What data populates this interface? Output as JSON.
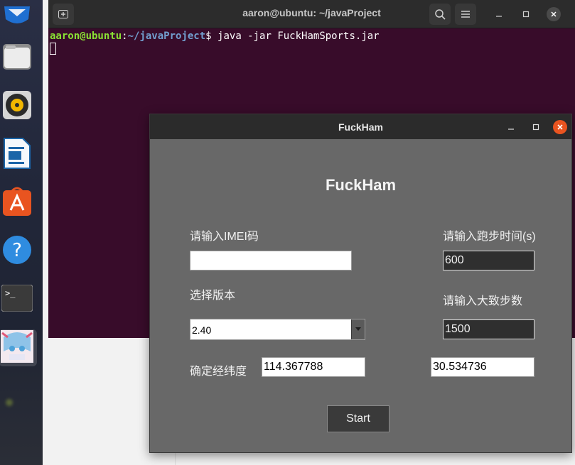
{
  "terminal": {
    "title": "aaron@ubuntu: ~/javaProject",
    "prompt_user": "aaron@ubuntu",
    "prompt_sep": ":",
    "prompt_path": "~/javaProject",
    "prompt_symbol": "$ ",
    "command": "java -jar FuckHamSports.jar"
  },
  "dialog": {
    "title": "FuckHam",
    "heading": "FuckHam",
    "imei_label": "请输入IMEI码",
    "imei_value": "",
    "run_time_label": "请输入跑步时间(s)",
    "run_time_value": "600",
    "version_label": "选择版本",
    "version_value": "2.40",
    "steps_label": "请输入大致步数",
    "steps_value": "1500",
    "coords_label": "确定经纬度",
    "longitude_value": "114.367788",
    "latitude_value": "30.534736",
    "start_label": "Start"
  },
  "dock": {
    "items": [
      "thunderbird-icon",
      "files-icon",
      "rhythmbox-icon",
      "libreoffice-writer-icon",
      "software-center-icon",
      "help-icon",
      "terminal-icon",
      "java-app-icon"
    ]
  },
  "colors": {
    "terminal_bg": "#380c2a",
    "dialog_bg": "#686868",
    "close_accent": "#e95420",
    "prompt_green": "#8ae234",
    "prompt_blue": "#729fcf"
  }
}
